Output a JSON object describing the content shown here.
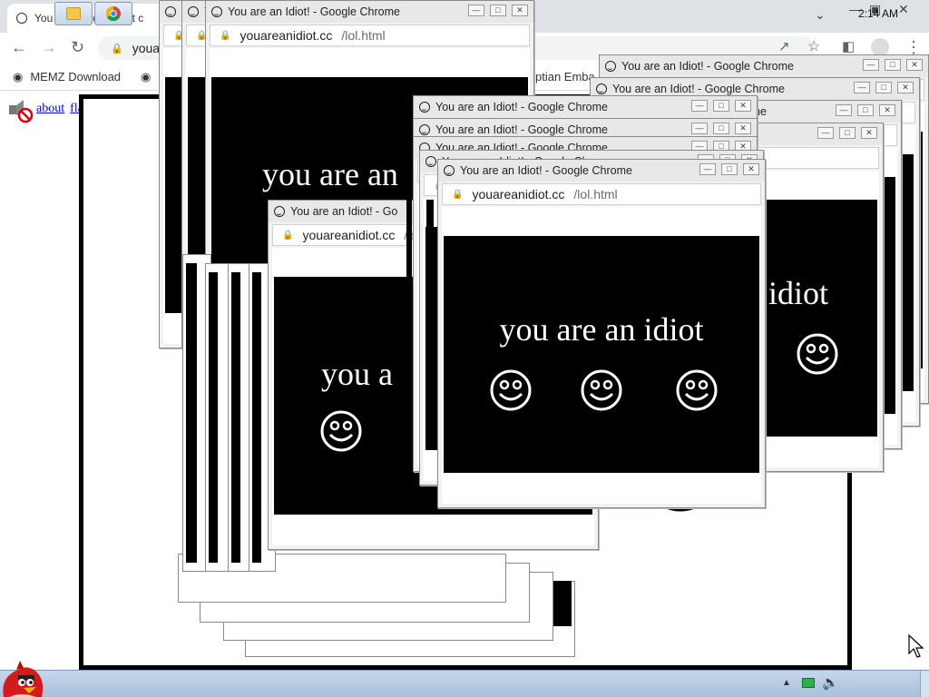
{
  "browser": {
    "tab_title": "You are an Idiot! (dot c",
    "url_partial": "youa",
    "bookmarks": [
      "MEMZ Download"
    ],
    "bookmark_partial": "ptian Emba",
    "page_links": [
      "about",
      "flash"
    ]
  },
  "popup": {
    "window_title": "You are an Idiot! - Google Chrome",
    "window_title_short": "You are an Idiot! - Go",
    "url_host": "youareanidiot.cc",
    "url_path": "/lol.html",
    "url_host_short": "youareanidiot.cc",
    "url_host_clipped": "youareanidiot.cc/lol.html",
    "message": "you are an idiot",
    "message_partial_a": "you are an",
    "message_partial_b": "you a",
    "message_partial_c": "idiot"
  },
  "taskbar": {
    "time": "2:14 AM"
  },
  "colors": {
    "black": "#000000",
    "white": "#ffffff",
    "link": "#0000ee",
    "taskbar": "#b8cbe3"
  },
  "icons": [
    "lock-icon",
    "smiley-icon",
    "back-arrow-icon",
    "forward-arrow-icon",
    "reload-icon",
    "share-icon",
    "star-icon",
    "profile-icon",
    "menu-dots-icon",
    "chrome-icon",
    "angry-bird-icon",
    "volume-icon",
    "network-icon",
    "flag-icon"
  ]
}
